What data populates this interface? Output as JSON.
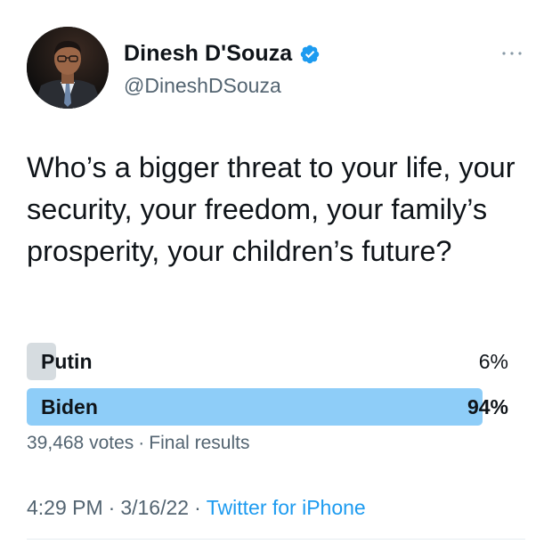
{
  "author": {
    "display_name": "Dinesh D'Souza",
    "handle": "@DineshDSouza",
    "verified": true,
    "verified_color": "#1d9bf0"
  },
  "tweet": {
    "text": "Who’s a bigger threat to your life, your security, your freedom, your family’s prosperity, your children’s future?"
  },
  "poll": {
    "options": [
      {
        "label": "Putin",
        "percent_text": "6%",
        "percent": 6,
        "winner": false
      },
      {
        "label": "Biden",
        "percent_text": "94%",
        "percent": 94,
        "winner": true
      }
    ],
    "votes": "39,468 votes",
    "separator": "·",
    "status": "Final results",
    "colors": {
      "winner_bar": "#8ecdf8",
      "other_bar": "#d6dce0"
    }
  },
  "footer": {
    "time": "4:29 PM",
    "date": "3/16/22",
    "separator": "·",
    "source": "Twitter for iPhone",
    "source_color": "#1d9bf0"
  }
}
